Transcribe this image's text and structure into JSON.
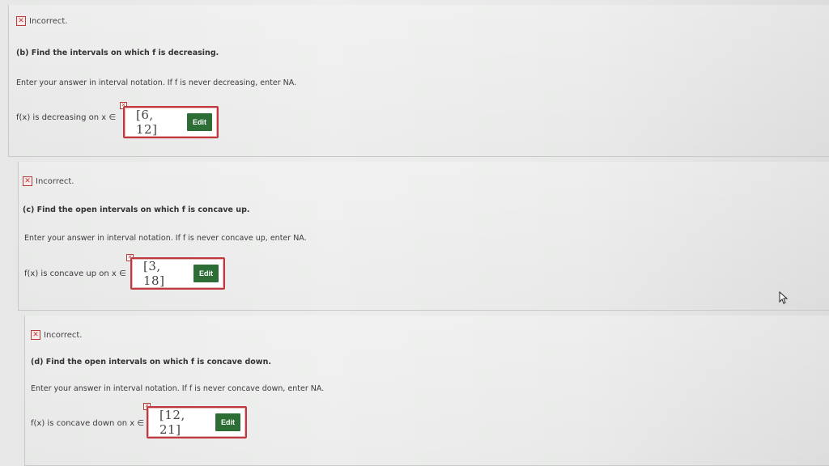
{
  "sections": [
    {
      "status": "Incorrect.",
      "question": "(b) Find the intervals on which f is decreasing.",
      "instruction": "Enter your answer in interval notation. If f is never decreasing, enter NA.",
      "prompt": "f(x) is decreasing on x ∈",
      "answer": "[6, 12]",
      "edit_label": "Edit"
    },
    {
      "status": "Incorrect.",
      "question": "(c) Find the open intervals on which f is concave up.",
      "instruction": "Enter your answer in interval notation. If f is never concave up, enter NA.",
      "prompt": "f(x) is concave up on x ∈",
      "answer": "[3, 18]",
      "edit_label": "Edit"
    },
    {
      "status": "Incorrect.",
      "question": "(d) Find the open intervals on which f is concave down.",
      "instruction": "Enter your answer in interval notation. If f is never concave down, enter NA.",
      "prompt": "f(x) is concave down on x ∈",
      "answer": "[12, 21]",
      "edit_label": "Edit"
    }
  ],
  "icons": {
    "incorrect": "x-mark-icon",
    "cursor": "mouse-pointer-icon"
  },
  "colors": {
    "error_red": "#c0393f",
    "edit_green": "#2d6e37"
  }
}
